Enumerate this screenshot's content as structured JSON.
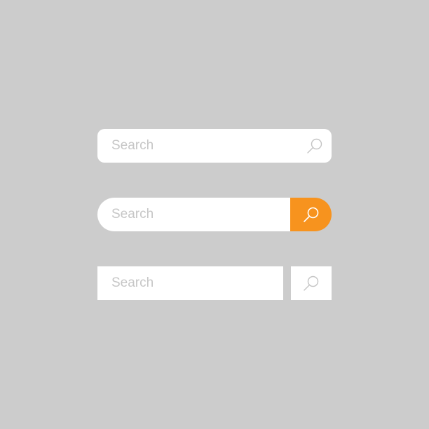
{
  "colors": {
    "background": "#cccccc",
    "field": "#ffffff",
    "placeholder_text": "#c6c6c6",
    "accent": "#f7931e",
    "icon_light": "#c4c4c4",
    "icon_on_accent": "#ffffff"
  },
  "search_bars": [
    {
      "placeholder": "Search",
      "style": "rounded-rectangle",
      "button_icon": "search-icon",
      "button_filled": false
    },
    {
      "placeholder": "Search",
      "style": "pill-with-orange-button",
      "button_icon": "search-icon",
      "button_filled": true
    },
    {
      "placeholder": "Search",
      "style": "square-with-separate-button",
      "button_icon": "search-icon",
      "button_filled": false
    }
  ]
}
